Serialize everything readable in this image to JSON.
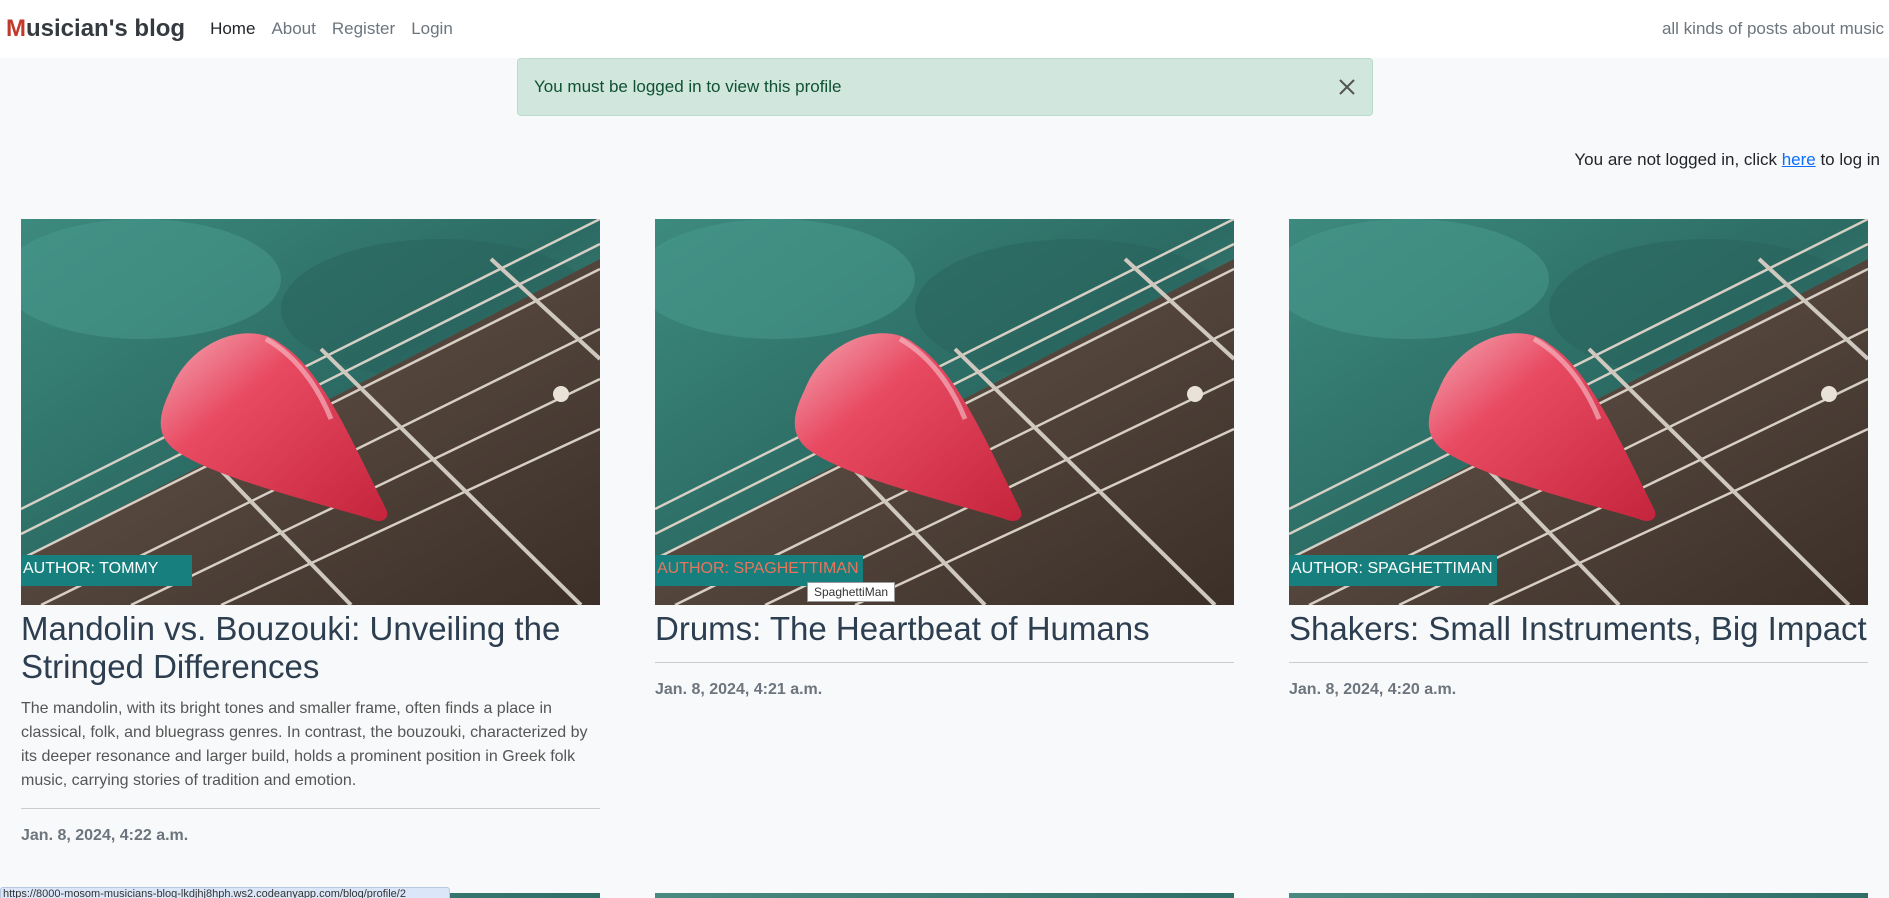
{
  "navbar": {
    "brand_first": "M",
    "brand_rest": "usician's blog",
    "links": [
      {
        "label": "Home",
        "active": true
      },
      {
        "label": "About",
        "active": false
      },
      {
        "label": "Register",
        "active": false
      },
      {
        "label": "Login",
        "active": false
      }
    ],
    "tagline": "all kinds of posts about music"
  },
  "alert": {
    "message": "You must be logged in to view this profile"
  },
  "login_note": {
    "before": "You are not logged in, click ",
    "link": "here",
    "after": " to log in"
  },
  "posts": [
    {
      "author": "Author: Tommy",
      "title": "Mandolin vs. Bouzouki: Unveiling the Stringed Differences",
      "excerpt": "The mandolin, with its bright tones and smaller frame, often finds a place in classical, folk, and bluegrass genres. In contrast, the bouzouki, characterized by its deeper resonance and larger build, holds a prominent position in Greek folk music, carrying stories of tradition and emotion.",
      "date": "Jan. 8, 2024, 4:22 a.m."
    },
    {
      "author": "Author: SpaghettiMan",
      "title": "Drums: The Heartbeat of Humans",
      "excerpt": "",
      "date": "Jan. 8, 2024, 4:21 a.m.",
      "tooltip": "SpaghettiMan"
    },
    {
      "author": "Author: SpaghettiMan",
      "title": "Shakers: Small Instruments, Big Impact",
      "excerpt": "",
      "date": "Jan. 8, 2024, 4:20 a.m."
    }
  ],
  "status_url": "https://8000-mosom-musicians-blog-lkdjhj8hph.ws2.codeanyapp.com/blog/profile/2"
}
